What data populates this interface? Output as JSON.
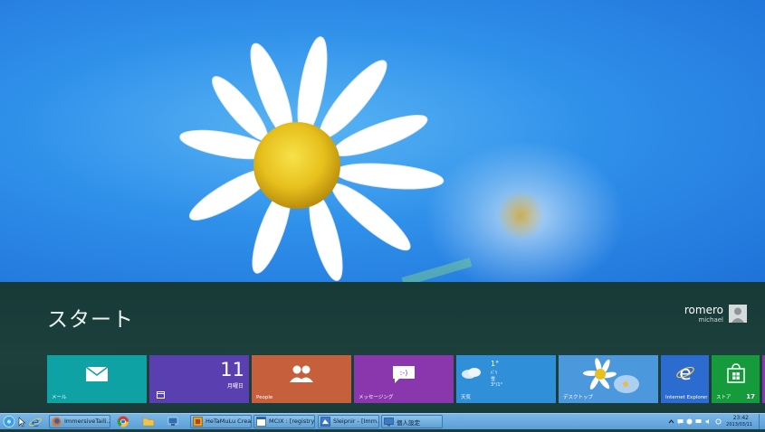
{
  "start": {
    "title": "スタート",
    "user": {
      "name": "romero",
      "subtitle": "michael"
    }
  },
  "tiles": {
    "mail": {
      "label": "メール"
    },
    "calendar": {
      "day": "11",
      "weekday": "月曜日"
    },
    "people": {
      "label": "People"
    },
    "messaging": {
      "label": "メッセージング"
    },
    "weather": {
      "label": "天気",
      "temp": "1°",
      "line1": "ﾊﾟﾘ",
      "line2": "雪",
      "line3": "3°/1°"
    },
    "desktop": {
      "label": "デスクトップ"
    },
    "ie": {
      "label": "Internet Explorer"
    },
    "store": {
      "label": "ストア",
      "count": "17"
    }
  },
  "taskbar": {
    "tasks": [
      {
        "label": "ImmersiveTaili..."
      },
      {
        "label": "HeTaMuLu Crea..."
      },
      {
        "label": "MCIX : [registry]"
      },
      {
        "label": "Sleipnir - [Imm..."
      },
      {
        "label": "個人設定"
      }
    ],
    "clock_time": "23:42",
    "clock_date": "2013/03/11"
  },
  "colors": {
    "start_bg": "#1d403d",
    "mail": "#0ea2a5",
    "calendar": "#5a3fb0",
    "people": "#c6603c",
    "messaging": "#8a36ad",
    "weather": "#2f8fd9",
    "store": "#159b3b"
  }
}
